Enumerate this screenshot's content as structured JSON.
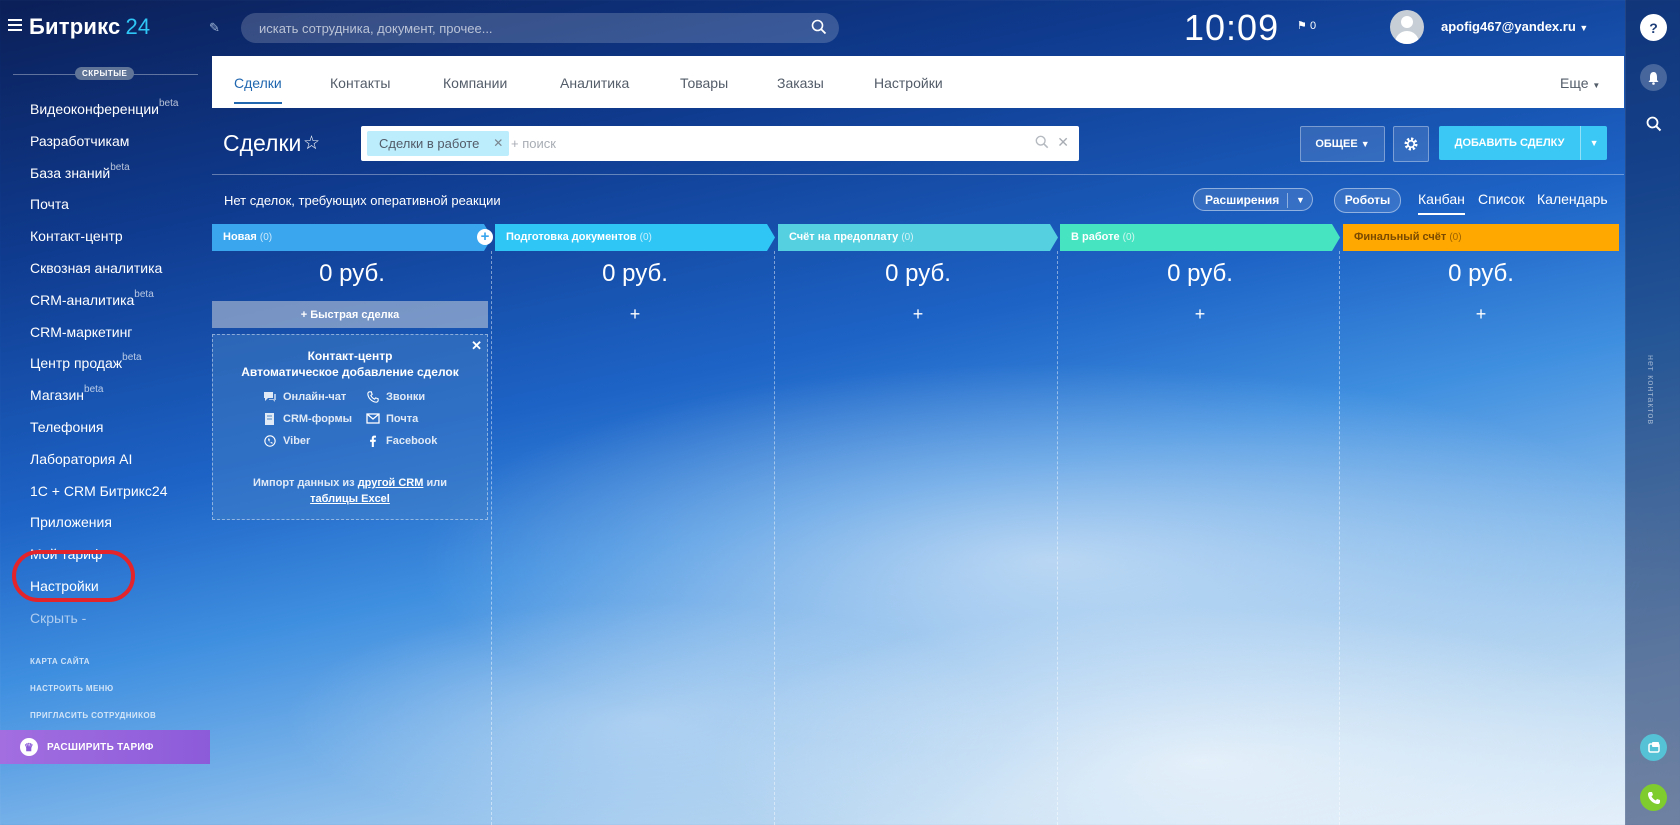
{
  "brand": {
    "name": "Битрикс",
    "number": "24"
  },
  "search": {
    "placeholder": "искать сотрудника, документ, прочее..."
  },
  "clock": "10:09",
  "flag_count": "0",
  "user": {
    "email": "apofig467@yandex.ru"
  },
  "sidebar": {
    "hidden_badge": "СКРЫТЫЕ",
    "items": [
      {
        "label": "Видеоконференции",
        "sup": "beta"
      },
      {
        "label": "Разработчикам",
        "sup": ""
      },
      {
        "label": "База знаний",
        "sup": "beta"
      },
      {
        "label": "Почта",
        "sup": ""
      },
      {
        "label": "Контакт-центр",
        "sup": ""
      },
      {
        "label": "Сквозная аналитика",
        "sup": ""
      },
      {
        "label": "CRM-аналитика",
        "sup": "beta"
      },
      {
        "label": "CRM-маркетинг",
        "sup": ""
      },
      {
        "label": "Центр продаж",
        "sup": "beta"
      },
      {
        "label": "Магазин",
        "sup": "beta"
      },
      {
        "label": "Телефония",
        "sup": ""
      },
      {
        "label": "Лаборатория AI",
        "sup": ""
      },
      {
        "label": "1С + CRM Битрикс24",
        "sup": ""
      },
      {
        "label": "Приложения",
        "sup": ""
      },
      {
        "label": "Мой тариф",
        "sup": ""
      },
      {
        "label": "Настройки",
        "sup": ""
      },
      {
        "label": "Скрыть -",
        "sup": ""
      }
    ],
    "links": [
      "КАРТА САЙТА",
      "НАСТРОИТЬ МЕНЮ",
      "ПРИГЛАСИТЬ СОТРУДНИКОВ"
    ],
    "upgrade": "РАСШИРИТЬ ТАРИФ"
  },
  "tabs": [
    "Сделки",
    "Контакты",
    "Компании",
    "Аналитика",
    "Товары",
    "Заказы",
    "Настройки"
  ],
  "tabs_more": "Еще",
  "page": {
    "title": "Сделки",
    "filter_chip": "Сделки в работе",
    "filter_placeholder": "+ поиск",
    "btn_common": "ОБЩЕЕ",
    "btn_add": "ДОБАВИТЬ СДЕЛКУ",
    "no_deals": "Нет сделок, требующих оперативной реакции",
    "btn_ext": "Расширения",
    "btn_robots": "Роботы",
    "views": [
      "Канбан",
      "Список",
      "Календарь"
    ]
  },
  "kanban": {
    "columns": [
      {
        "name": "Новая",
        "count": "(0)",
        "sum": "0 руб.",
        "color": "#3aa6ee"
      },
      {
        "name": "Подготовка документов",
        "count": "(0)",
        "sum": "0 руб.",
        "color": "#2fc6f6"
      },
      {
        "name": "Счёт на предоплату",
        "count": "(0)",
        "sum": "0 руб.",
        "color": "#55d0e0"
      },
      {
        "name": "В работе",
        "count": "(0)",
        "sum": "0 руб.",
        "color": "#47e4c2"
      },
      {
        "name": "Финальный счёт",
        "count": "(0)",
        "sum": "0 руб.",
        "color": "#ffa900"
      }
    ],
    "quick_deal": "+ Быстрая сделка",
    "plus": "+",
    "contact_center": {
      "title": "Контакт-центр",
      "subtitle": "Автоматическое добавление сделок",
      "channels": [
        "Онлайн-чат",
        "Звонки",
        "CRM-формы",
        "Почта",
        "Viber",
        "Facebook"
      ],
      "import_prefix": "Импорт данных из",
      "import_link1": "другой CRM",
      "import_mid": "или",
      "import_link2": "таблицы Excel"
    }
  },
  "rail": {
    "vertical_text": "нет контактов"
  }
}
